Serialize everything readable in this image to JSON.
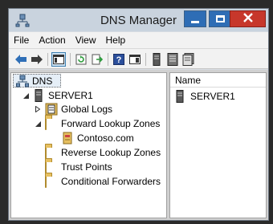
{
  "window": {
    "title": "DNS Manager",
    "controls": {
      "minimize": "minimize",
      "maximize": "maximize",
      "close": "close"
    }
  },
  "menu": [
    "File",
    "Action",
    "View",
    "Help"
  ],
  "toolbar": [
    {
      "icon": "back-arrow-icon"
    },
    {
      "icon": "forward-arrow-icon"
    },
    {
      "icon": "show-hide-console-tree-icon"
    },
    {
      "icon": "refresh-icon"
    },
    {
      "icon": "export-list-icon"
    },
    {
      "icon": "help-icon"
    },
    {
      "icon": "properties-pane-icon"
    },
    {
      "icon": "server-icon"
    },
    {
      "icon": "zone-file-icon"
    },
    {
      "icon": "records-icon"
    }
  ],
  "tree": {
    "root": "DNS",
    "server": "SERVER1",
    "items": {
      "global_logs": "Global Logs",
      "forward_lookup_zones": "Forward Lookup Zones",
      "contoso": "Contoso.com",
      "reverse_lookup_zones": "Reverse Lookup Zones",
      "trust_points": "Trust Points",
      "conditional_forwarders": "Conditional Forwarders"
    }
  },
  "list": {
    "column_name": "Name",
    "rows": [
      "SERVER1"
    ]
  },
  "colors": {
    "title_bar": "#c9d3de",
    "close_button": "#c7372b",
    "window_buttons": "#2e6db5",
    "folder": "#e7c061"
  }
}
